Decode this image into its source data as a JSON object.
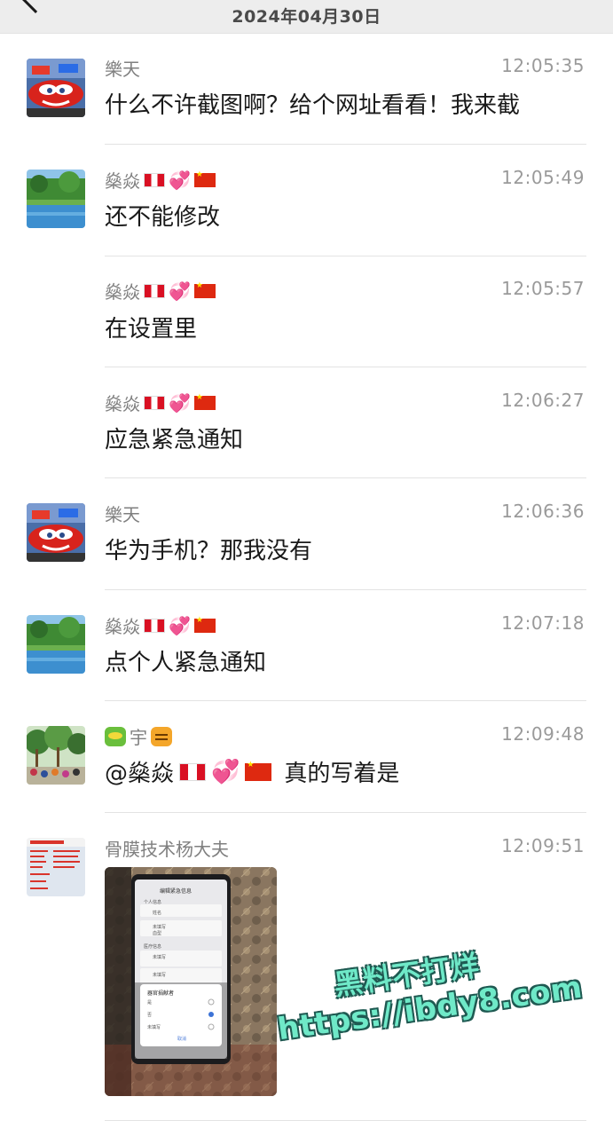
{
  "header": {
    "date": "2024年04月30日"
  },
  "messages": [
    {
      "sender": "樂天",
      "time": "12:05:35",
      "text": "什么不许截图啊？给个网址看看！我来截",
      "avatar": "cars-lightning-avatar"
    },
    {
      "sender": "燊焱",
      "time": "12:05:49",
      "text": "还不能修改",
      "avatar": "lake-landscape-avatar"
    },
    {
      "sender": "燊焱",
      "time": "12:05:57",
      "text": "在设置里"
    },
    {
      "sender": "燊焱",
      "time": "12:06:27",
      "text": "应急紧急通知"
    },
    {
      "sender": "樂天",
      "time": "12:06:36",
      "text": "华为手机？那我没有",
      "avatar": "cars-lightning-avatar"
    },
    {
      "sender": "燊焱",
      "time": "12:07:18",
      "text": "点个人紧急通知",
      "avatar": "lake-landscape-avatar"
    },
    {
      "sender": "宇",
      "time": "12:09:48",
      "text_mention": "@燊焱",
      "text": "真的写着是",
      "avatar": "park-crowd-avatar"
    },
    {
      "sender": "骨膜技术杨大夫",
      "time": "12:09:51",
      "avatar": "clinic-poster-avatar",
      "image": {
        "phone_title": "编辑紧急信息",
        "phone_items": [
          "个人信息",
          "姓名",
          "未填写",
          "血型",
          "医疗信息",
          "未填写",
          "未填写"
        ],
        "dialog_title": "器官捐献者",
        "dialog_options": [
          "是",
          "否",
          "未填写"
        ],
        "dialog_cancel": "取消"
      }
    }
  ],
  "watermark": {
    "line1": "黑料不打烊",
    "line2": "https://ibdy8.com"
  },
  "colors": {
    "heart": "#e24fd0",
    "watermark_fill": "#6fe9c8",
    "watermark_outline": "#1f5a52"
  }
}
